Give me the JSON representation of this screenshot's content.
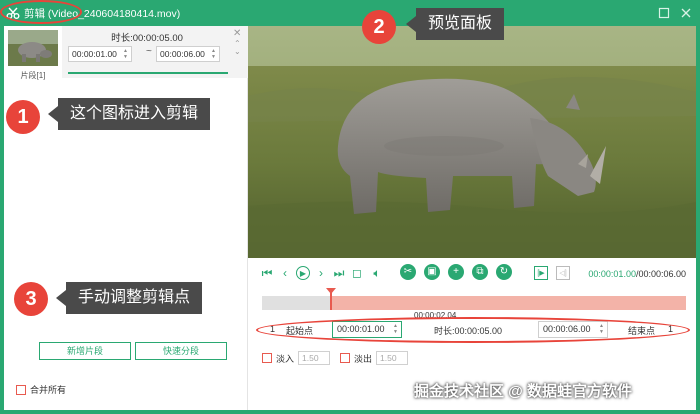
{
  "titlebar": {
    "title": "剪辑 (Video_240604180414.mov)"
  },
  "clip_panel": {
    "thumb_label": "片段[1]",
    "duration_label": "时长:00:00:05.00",
    "start_time": "00:00:01.00",
    "end_time": "00:00:06.00",
    "separator": "~",
    "add_segment_label": "新增片段",
    "quick_split_label": "快速分段",
    "merge_all_label": "合并所有"
  },
  "player": {
    "current_time": "00:00:01.00",
    "total_time": "/00:00:06.00"
  },
  "timeline": {
    "playhead_stamp": "00:00:02.04",
    "index_left": "1",
    "index_right": "1",
    "start_label": "起始点",
    "start_value": "00:00:01.00",
    "duration_label": "时长:00:00:05.00",
    "end_value": "00:00:06.00",
    "end_label": "结束点"
  },
  "fade": {
    "fade_in_label": "淡入",
    "fade_in_value": "1.50",
    "fade_out_label": "淡出",
    "fade_out_value": "1.50"
  },
  "annotations": {
    "badge_1": "1",
    "callout_1": "这个图标进入剪辑",
    "badge_2": "2",
    "callout_2": "预览面板",
    "badge_3": "3",
    "callout_3": "手动调整剪辑点"
  },
  "watermark": "掘金技术社区 @ 数据蛙官方软件",
  "colors": {
    "accent": "#2aa872",
    "annotation_red": "#e8443a",
    "callout_bg": "#4a4a4a"
  }
}
